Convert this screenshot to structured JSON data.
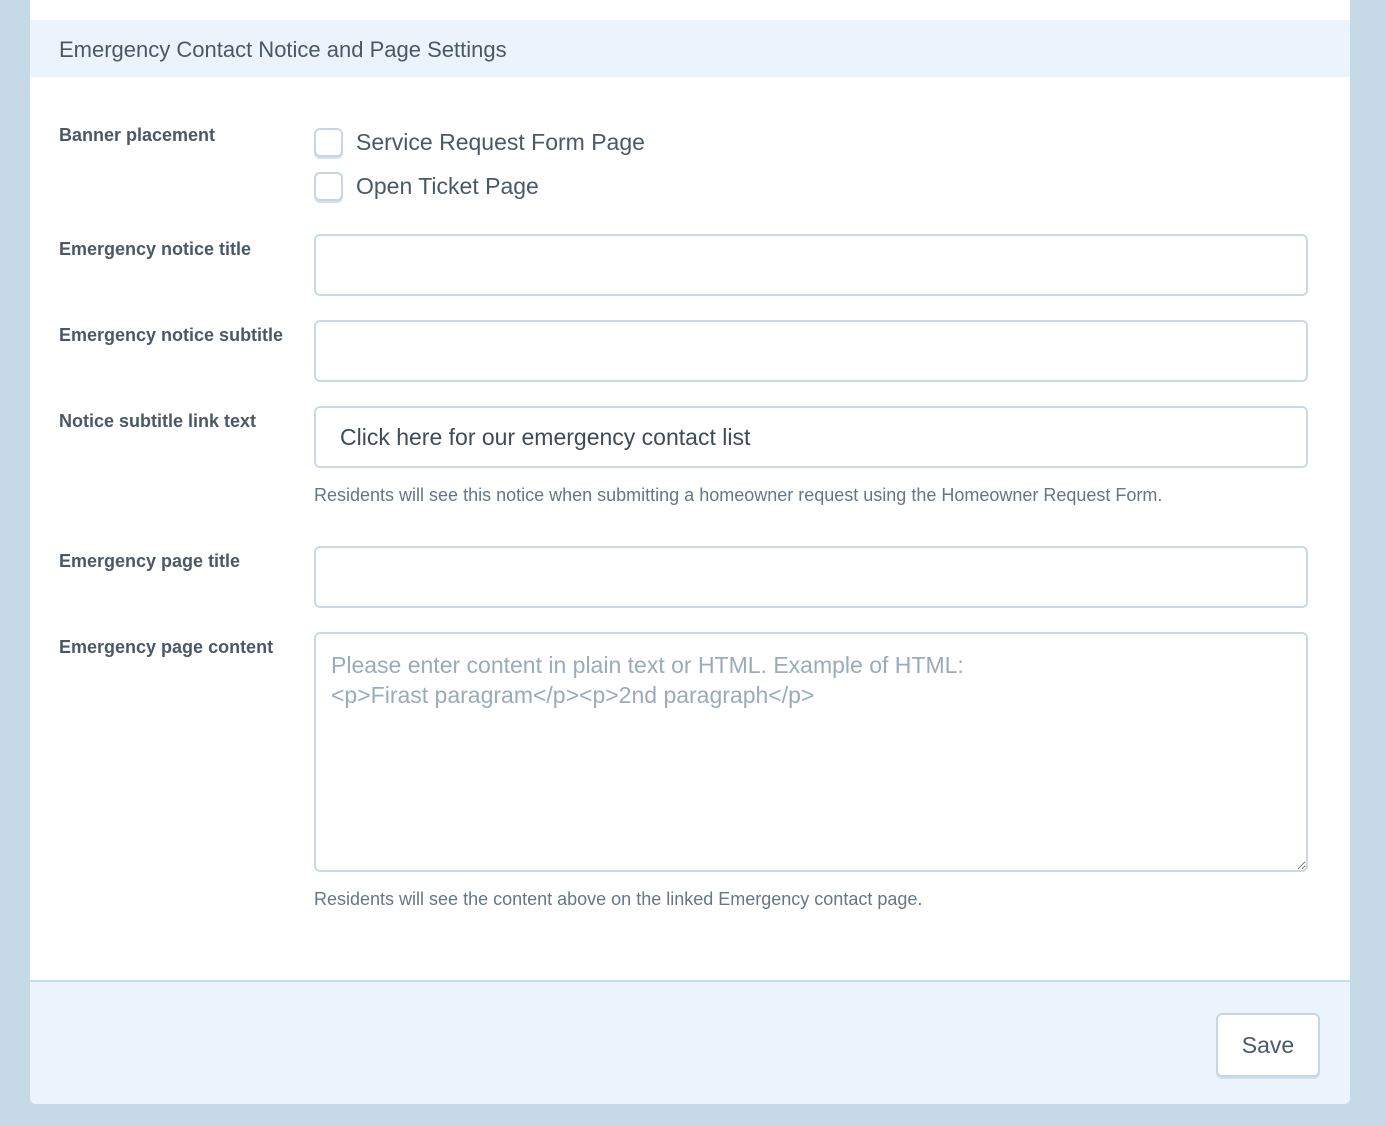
{
  "header": {
    "title": "Emergency Contact Notice and Page Settings"
  },
  "banner_placement": {
    "label": "Banner placement",
    "options": [
      {
        "label": "Service Request Form Page",
        "checked": false
      },
      {
        "label": "Open Ticket Page",
        "checked": false
      }
    ]
  },
  "notice_title": {
    "label": "Emergency notice title",
    "value": ""
  },
  "notice_subtitle": {
    "label": "Emergency notice subtitle",
    "value": ""
  },
  "subtitle_link_text": {
    "label": "Notice subtitle link text",
    "value": "Click here for our emergency contact list",
    "help": "Residents will see this notice when submitting a homeowner request using the Homeowner Request Form."
  },
  "page_title": {
    "label": "Emergency page title",
    "value": ""
  },
  "page_content": {
    "label": "Emergency page content",
    "value": "",
    "placeholder": "Please enter content in plain text or HTML. Example of HTML:\n<p>Firast paragram</p><p>2nd paragraph</p>",
    "help": "Residents will see the content above on the linked Emergency contact page."
  },
  "footer": {
    "save_label": "Save"
  }
}
